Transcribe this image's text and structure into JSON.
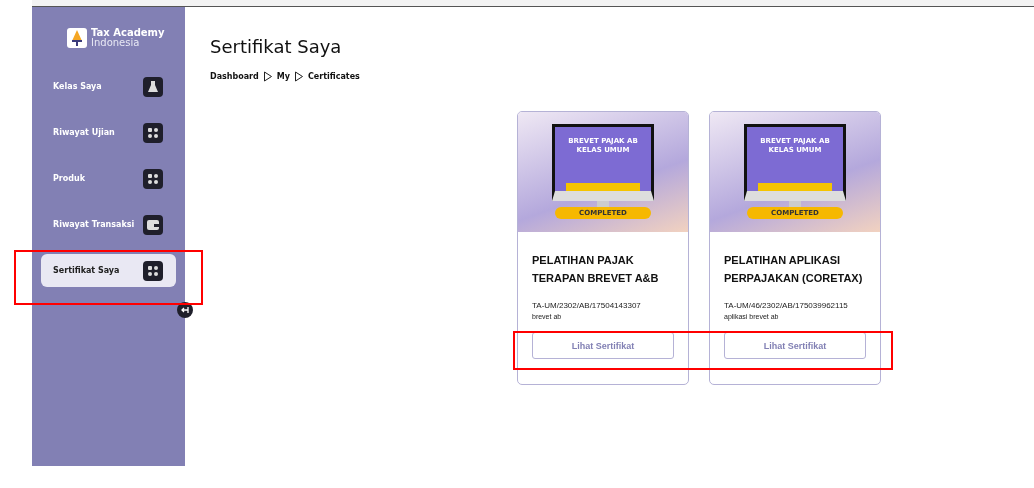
{
  "brand": {
    "name": "Tax Academy",
    "sub": "Indonesia"
  },
  "sidebar": {
    "items": [
      {
        "label": "Kelas Saya",
        "kind": "flask",
        "selected": false
      },
      {
        "label": "Riwayat Ujian",
        "kind": "grid",
        "selected": false
      },
      {
        "label": "Produk",
        "kind": "grid",
        "selected": false
      },
      {
        "label": "Riwayat Transaksi",
        "kind": "wallet",
        "selected": false
      },
      {
        "label": "Sertifikat Saya",
        "kind": "grid",
        "selected": true
      }
    ]
  },
  "page": {
    "title": "Sertifikat Saya",
    "breadcrumb": [
      "Dashboard",
      "My",
      "Certificates"
    ]
  },
  "certificates": [
    {
      "banner": "BREVET PAJAK AB KELAS UMUM",
      "badge": "COMPLETED",
      "title": "PELATIHAN PAJAK TERAPAN BREVET A&B",
      "code": "TA-UM/2302/AB/17504143307",
      "category": "brevet ab",
      "button": "Lihat Sertifikat"
    },
    {
      "banner": "BREVET PAJAK AB KELAS UMUM",
      "badge": "COMPLETED",
      "title": "PELATIHAN APLIKASI PERPAJAKAN (CORETAX)",
      "code": "TA-UM/46/2302/AB/175039962115",
      "category": "aplikasi brevet ab",
      "button": "Lihat Sertifikat"
    }
  ]
}
